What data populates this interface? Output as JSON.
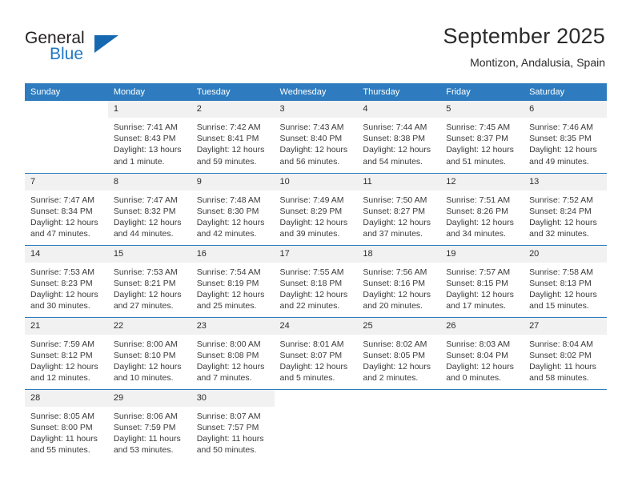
{
  "brand": {
    "name_top": "General",
    "name_bottom": "Blue",
    "accent_color": "#1669b0",
    "text_color": "#231f20"
  },
  "header": {
    "title": "September 2025",
    "subtitle": "Montizon, Andalusia, Spain"
  },
  "theme": {
    "header_row_bg": "#2e7cbf",
    "header_row_text": "#ffffff",
    "daynum_bg": "#f1f1f1",
    "row_divider": "#2e7cbf",
    "body_text": "#3a3a3a"
  },
  "weekday_headers": [
    "Sunday",
    "Monday",
    "Tuesday",
    "Wednesday",
    "Thursday",
    "Friday",
    "Saturday"
  ],
  "weeks": [
    {
      "days": [
        {
          "num": "",
          "sunrise": "",
          "sunset": "",
          "daylight_1": "",
          "daylight_2": "",
          "blank": true
        },
        {
          "num": "1",
          "sunrise": "Sunrise: 7:41 AM",
          "sunset": "Sunset: 8:43 PM",
          "daylight_1": "Daylight: 13 hours",
          "daylight_2": "and 1 minute."
        },
        {
          "num": "2",
          "sunrise": "Sunrise: 7:42 AM",
          "sunset": "Sunset: 8:41 PM",
          "daylight_1": "Daylight: 12 hours",
          "daylight_2": "and 59 minutes."
        },
        {
          "num": "3",
          "sunrise": "Sunrise: 7:43 AM",
          "sunset": "Sunset: 8:40 PM",
          "daylight_1": "Daylight: 12 hours",
          "daylight_2": "and 56 minutes."
        },
        {
          "num": "4",
          "sunrise": "Sunrise: 7:44 AM",
          "sunset": "Sunset: 8:38 PM",
          "daylight_1": "Daylight: 12 hours",
          "daylight_2": "and 54 minutes."
        },
        {
          "num": "5",
          "sunrise": "Sunrise: 7:45 AM",
          "sunset": "Sunset: 8:37 PM",
          "daylight_1": "Daylight: 12 hours",
          "daylight_2": "and 51 minutes."
        },
        {
          "num": "6",
          "sunrise": "Sunrise: 7:46 AM",
          "sunset": "Sunset: 8:35 PM",
          "daylight_1": "Daylight: 12 hours",
          "daylight_2": "and 49 minutes."
        }
      ]
    },
    {
      "days": [
        {
          "num": "7",
          "sunrise": "Sunrise: 7:47 AM",
          "sunset": "Sunset: 8:34 PM",
          "daylight_1": "Daylight: 12 hours",
          "daylight_2": "and 47 minutes."
        },
        {
          "num": "8",
          "sunrise": "Sunrise: 7:47 AM",
          "sunset": "Sunset: 8:32 PM",
          "daylight_1": "Daylight: 12 hours",
          "daylight_2": "and 44 minutes."
        },
        {
          "num": "9",
          "sunrise": "Sunrise: 7:48 AM",
          "sunset": "Sunset: 8:30 PM",
          "daylight_1": "Daylight: 12 hours",
          "daylight_2": "and 42 minutes."
        },
        {
          "num": "10",
          "sunrise": "Sunrise: 7:49 AM",
          "sunset": "Sunset: 8:29 PM",
          "daylight_1": "Daylight: 12 hours",
          "daylight_2": "and 39 minutes."
        },
        {
          "num": "11",
          "sunrise": "Sunrise: 7:50 AM",
          "sunset": "Sunset: 8:27 PM",
          "daylight_1": "Daylight: 12 hours",
          "daylight_2": "and 37 minutes."
        },
        {
          "num": "12",
          "sunrise": "Sunrise: 7:51 AM",
          "sunset": "Sunset: 8:26 PM",
          "daylight_1": "Daylight: 12 hours",
          "daylight_2": "and 34 minutes."
        },
        {
          "num": "13",
          "sunrise": "Sunrise: 7:52 AM",
          "sunset": "Sunset: 8:24 PM",
          "daylight_1": "Daylight: 12 hours",
          "daylight_2": "and 32 minutes."
        }
      ]
    },
    {
      "days": [
        {
          "num": "14",
          "sunrise": "Sunrise: 7:53 AM",
          "sunset": "Sunset: 8:23 PM",
          "daylight_1": "Daylight: 12 hours",
          "daylight_2": "and 30 minutes."
        },
        {
          "num": "15",
          "sunrise": "Sunrise: 7:53 AM",
          "sunset": "Sunset: 8:21 PM",
          "daylight_1": "Daylight: 12 hours",
          "daylight_2": "and 27 minutes."
        },
        {
          "num": "16",
          "sunrise": "Sunrise: 7:54 AM",
          "sunset": "Sunset: 8:19 PM",
          "daylight_1": "Daylight: 12 hours",
          "daylight_2": "and 25 minutes."
        },
        {
          "num": "17",
          "sunrise": "Sunrise: 7:55 AM",
          "sunset": "Sunset: 8:18 PM",
          "daylight_1": "Daylight: 12 hours",
          "daylight_2": "and 22 minutes."
        },
        {
          "num": "18",
          "sunrise": "Sunrise: 7:56 AM",
          "sunset": "Sunset: 8:16 PM",
          "daylight_1": "Daylight: 12 hours",
          "daylight_2": "and 20 minutes."
        },
        {
          "num": "19",
          "sunrise": "Sunrise: 7:57 AM",
          "sunset": "Sunset: 8:15 PM",
          "daylight_1": "Daylight: 12 hours",
          "daylight_2": "and 17 minutes."
        },
        {
          "num": "20",
          "sunrise": "Sunrise: 7:58 AM",
          "sunset": "Sunset: 8:13 PM",
          "daylight_1": "Daylight: 12 hours",
          "daylight_2": "and 15 minutes."
        }
      ]
    },
    {
      "days": [
        {
          "num": "21",
          "sunrise": "Sunrise: 7:59 AM",
          "sunset": "Sunset: 8:12 PM",
          "daylight_1": "Daylight: 12 hours",
          "daylight_2": "and 12 minutes."
        },
        {
          "num": "22",
          "sunrise": "Sunrise: 8:00 AM",
          "sunset": "Sunset: 8:10 PM",
          "daylight_1": "Daylight: 12 hours",
          "daylight_2": "and 10 minutes."
        },
        {
          "num": "23",
          "sunrise": "Sunrise: 8:00 AM",
          "sunset": "Sunset: 8:08 PM",
          "daylight_1": "Daylight: 12 hours",
          "daylight_2": "and 7 minutes."
        },
        {
          "num": "24",
          "sunrise": "Sunrise: 8:01 AM",
          "sunset": "Sunset: 8:07 PM",
          "daylight_1": "Daylight: 12 hours",
          "daylight_2": "and 5 minutes."
        },
        {
          "num": "25",
          "sunrise": "Sunrise: 8:02 AM",
          "sunset": "Sunset: 8:05 PM",
          "daylight_1": "Daylight: 12 hours",
          "daylight_2": "and 2 minutes."
        },
        {
          "num": "26",
          "sunrise": "Sunrise: 8:03 AM",
          "sunset": "Sunset: 8:04 PM",
          "daylight_1": "Daylight: 12 hours",
          "daylight_2": "and 0 minutes."
        },
        {
          "num": "27",
          "sunrise": "Sunrise: 8:04 AM",
          "sunset": "Sunset: 8:02 PM",
          "daylight_1": "Daylight: 11 hours",
          "daylight_2": "and 58 minutes."
        }
      ]
    },
    {
      "days": [
        {
          "num": "28",
          "sunrise": "Sunrise: 8:05 AM",
          "sunset": "Sunset: 8:00 PM",
          "daylight_1": "Daylight: 11 hours",
          "daylight_2": "and 55 minutes."
        },
        {
          "num": "29",
          "sunrise": "Sunrise: 8:06 AM",
          "sunset": "Sunset: 7:59 PM",
          "daylight_1": "Daylight: 11 hours",
          "daylight_2": "and 53 minutes."
        },
        {
          "num": "30",
          "sunrise": "Sunrise: 8:07 AM",
          "sunset": "Sunset: 7:57 PM",
          "daylight_1": "Daylight: 11 hours",
          "daylight_2": "and 50 minutes."
        },
        {
          "num": "",
          "sunrise": "",
          "sunset": "",
          "daylight_1": "",
          "daylight_2": "",
          "blank": true
        },
        {
          "num": "",
          "sunrise": "",
          "sunset": "",
          "daylight_1": "",
          "daylight_2": "",
          "blank": true
        },
        {
          "num": "",
          "sunrise": "",
          "sunset": "",
          "daylight_1": "",
          "daylight_2": "",
          "blank": true
        },
        {
          "num": "",
          "sunrise": "",
          "sunset": "",
          "daylight_1": "",
          "daylight_2": "",
          "blank": true
        }
      ]
    }
  ]
}
